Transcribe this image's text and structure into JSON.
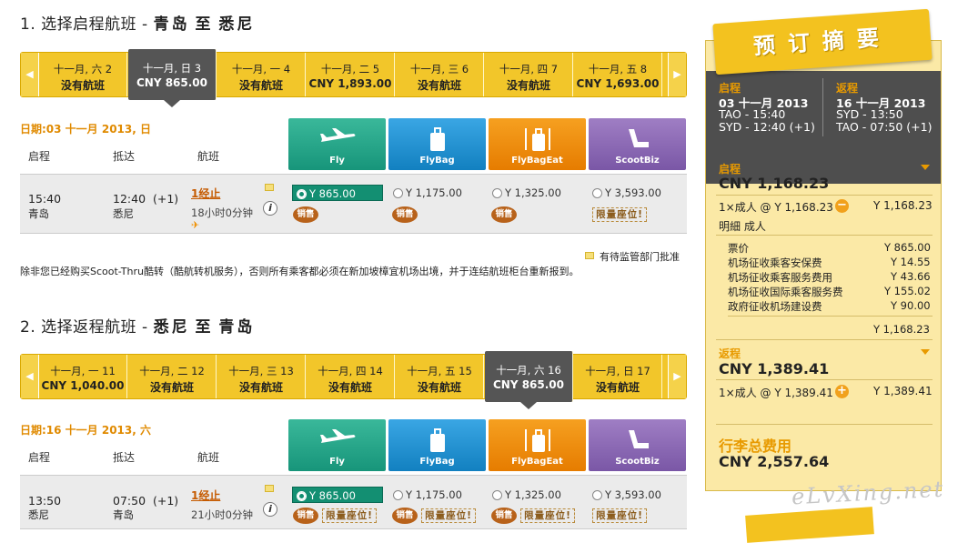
{
  "outbound": {
    "num": "1.",
    "title": "选择启程航班 -",
    "from": "青岛",
    "to_word": "至",
    "to": "悉尼",
    "dates": [
      {
        "d": "十一月, 六 2",
        "p": "没有航班"
      },
      {
        "d": "十一月, 日 3",
        "p": "CNY 865.00"
      },
      {
        "d": "十一月, 一 4",
        "p": "没有航班"
      },
      {
        "d": "十一月, 二 5",
        "p": "CNY 1,893.00"
      },
      {
        "d": "十一月, 三 6",
        "p": "没有航班"
      },
      {
        "d": "十一月, 四 7",
        "p": "没有航班"
      },
      {
        "d": "十一月, 五 8",
        "p": "CNY 1,693.00"
      }
    ],
    "date_label": "日期:03 十一月 2013, 日",
    "row": {
      "dep_time": "15:40",
      "dep_city": "青岛",
      "arr_time": "12:40",
      "arr_offset": "(+1)",
      "arr_city": "悉尼",
      "stops": "1经止",
      "duration": "18小时0分钟",
      "fares": [
        "Y 865.00",
        "Y 1,175.00",
        "Y 1,325.00",
        "Y 3,593.00"
      ],
      "sale": "销售",
      "limited": "限量座位!"
    }
  },
  "note": "有待监管部门批准",
  "transfer_text": "除非您已经购买Scoot-Thru酷转（酷航转机服务），否则所有乘客都必须在新加坡樟宜机场出境，并于连结航班柜台重新报到。",
  "inbound": {
    "num": "2.",
    "title": "选择返程航班 -",
    "from": "悉尼",
    "to_word": "至",
    "to": "青岛",
    "dates": [
      {
        "d": "十一月, 一 11",
        "p": "CNY 1,040.00"
      },
      {
        "d": "十一月, 二 12",
        "p": "没有航班"
      },
      {
        "d": "十一月, 三 13",
        "p": "没有航班"
      },
      {
        "d": "十一月, 四 14",
        "p": "没有航班"
      },
      {
        "d": "十一月, 五 15",
        "p": "没有航班"
      },
      {
        "d": "十一月, 六 16",
        "p": "CNY 865.00"
      },
      {
        "d": "十一月, 日 17",
        "p": "没有航班"
      }
    ],
    "date_label": "日期:16 十一月 2013, 六",
    "row": {
      "dep_time": "13:50",
      "dep_city": "悉尼",
      "arr_time": "07:50",
      "arr_offset": "(+1)",
      "arr_city": "青岛",
      "stops": "1经止",
      "duration": "21小时0分钟",
      "fares": [
        "Y 865.00",
        "Y 1,175.00",
        "Y 1,325.00",
        "Y 3,593.00"
      ],
      "sale": "销售",
      "limited": "限量座位!"
    }
  },
  "columns": {
    "depart": "启程",
    "arrive": "抵达",
    "flight": "航班"
  },
  "fare_types": [
    "Fly",
    "FlyBag",
    "FlyBagEat",
    "ScootBiz"
  ],
  "summary": {
    "banner": "预订摘要",
    "out": {
      "label": "启程",
      "date": "03 十一月 2013",
      "l1": "TAO - 15:40",
      "l2": "SYD - 12:40 (+1)"
    },
    "ret": {
      "label": "返程",
      "date": "16 十一月 2013",
      "l1": "SYD - 13:50",
      "l2": "TAO - 07:50 (+1)"
    },
    "out_price": {
      "label": "启程",
      "total": "CNY 1,168.23",
      "pax": "1×成人 @ Y 1,168.23",
      "pax_total": "Y 1,168.23",
      "name": "明細 成人",
      "items": [
        {
          "k": "票价",
          "v": "Y 865.00"
        },
        {
          "k": "机场征收乘客安保费",
          "v": "Y 14.55"
        },
        {
          "k": "机场征收乘客服务费用",
          "v": "Y 43.66"
        },
        {
          "k": "机场征收国际乘客服务费",
          "v": "Y 155.02"
        },
        {
          "k": "政府征收机场建设费",
          "v": "Y 90.00"
        }
      ],
      "sum": "Y 1,168.23"
    },
    "ret_price": {
      "label": "返程",
      "total": "CNY 1,389.41",
      "pax": "1×成人 @ Y 1,389.41",
      "pax_total": "Y 1,389.41"
    },
    "grand": {
      "label": "行李总费用",
      "total": "CNY 2,557.64"
    }
  },
  "watermark": "eLvXing.net"
}
